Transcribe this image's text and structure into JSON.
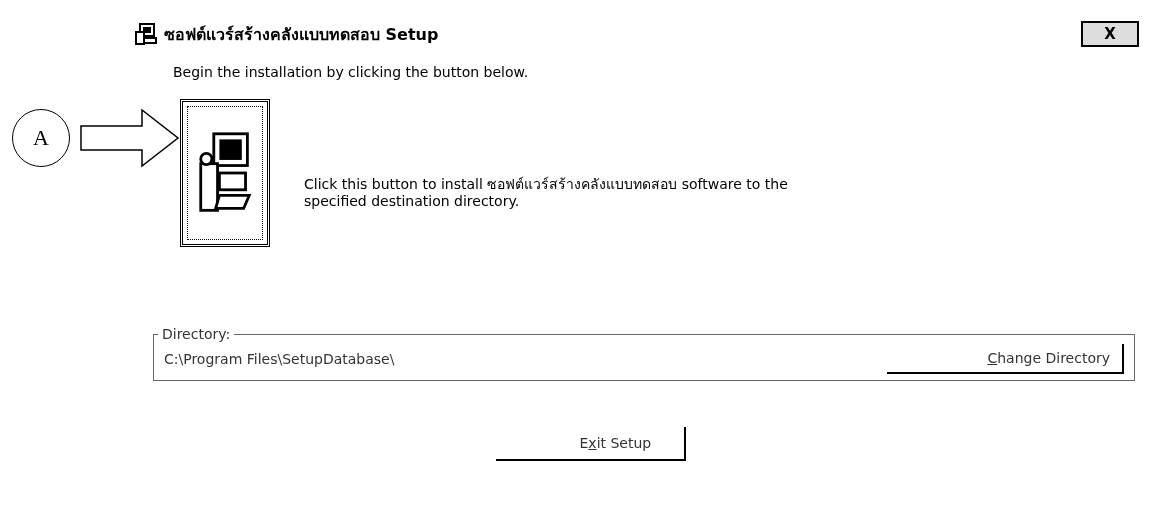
{
  "window": {
    "title": "ซอฟต์แวร์สร้างคลังแบบทดสอบ Setup",
    "close_label": "X"
  },
  "intro": "Begin the installation by clicking the button below.",
  "callout": {
    "label": "A"
  },
  "install": {
    "description": "Click this button to install ซอฟต์แวร์สร้างคลังแบบทดสอบ software to the specified destination directory."
  },
  "directory": {
    "legend": "Directory:",
    "path": "C:\\Program Files\\SetupDatabase\\",
    "button": {
      "key": "C",
      "after": "hange Directory"
    }
  },
  "exit_button": {
    "before": "E",
    "key": "x",
    "after": "it Setup"
  }
}
